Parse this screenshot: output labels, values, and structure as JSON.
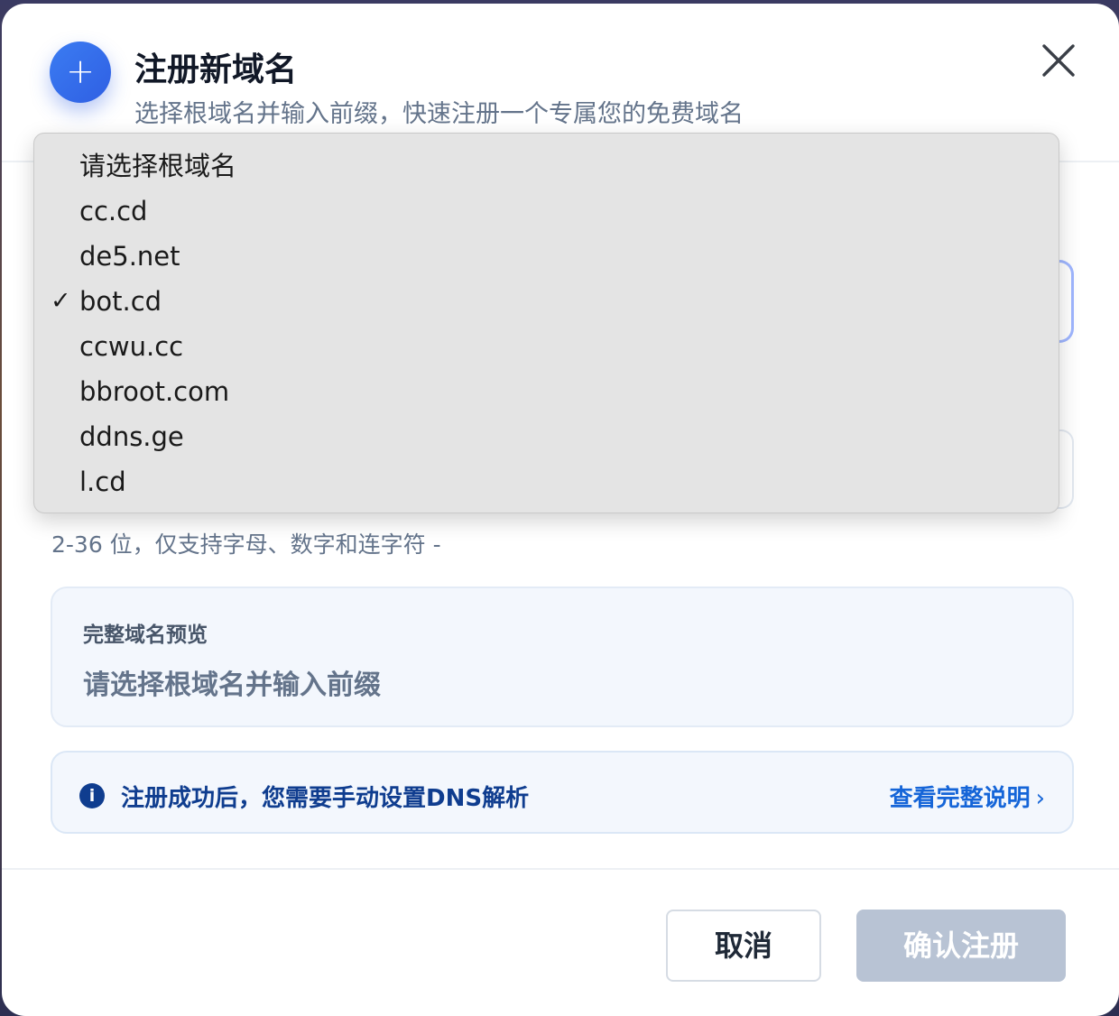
{
  "header": {
    "icon": "plus-icon",
    "icon_glyph": "+",
    "title": "注册新域名",
    "subtitle": "选择根域名并输入前缀，快速注册一个专属您的免费域名"
  },
  "root_domain_select": {
    "options": [
      {
        "label": "请选择根域名",
        "selected": false
      },
      {
        "label": "cc.cd",
        "selected": false
      },
      {
        "label": "de5.net",
        "selected": false
      },
      {
        "label": "bot.cd",
        "selected": true
      },
      {
        "label": "ccwu.cc",
        "selected": false
      },
      {
        "label": "bbroot.com",
        "selected": false
      },
      {
        "label": "ddns.ge",
        "selected": false
      },
      {
        "label": "l.cd",
        "selected": false
      }
    ],
    "check_glyph": "✓"
  },
  "prefix": {
    "hint": "2-36 位，仅支持字母、数字和连字符 -"
  },
  "preview": {
    "label": "完整域名预览",
    "value": "请选择根域名并输入前缀"
  },
  "info": {
    "icon": "info-icon",
    "icon_glyph": "i",
    "text": "注册成功后，您需要手动设置DNS解析",
    "link_label": "查看完整说明",
    "link_chevron": "›"
  },
  "footer": {
    "cancel_label": "取消",
    "confirm_label": "确认注册"
  },
  "colors": {
    "accent": "#2f5fe3",
    "info_text": "#0f3d8f",
    "link": "#1565d8",
    "disabled_button": "#b8c3d4"
  }
}
